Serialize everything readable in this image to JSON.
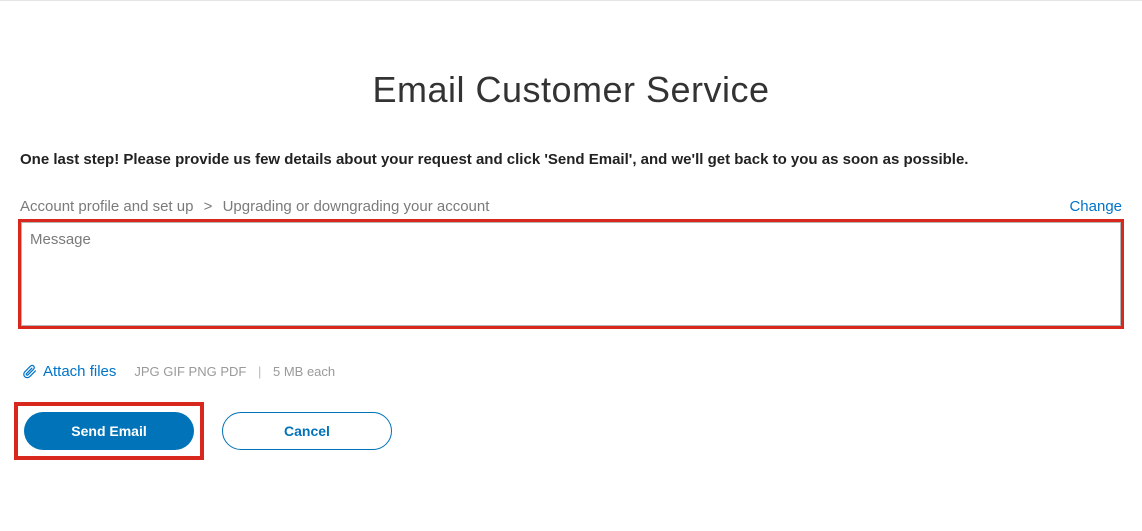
{
  "page": {
    "title": "Email Customer Service",
    "instruction": "One last step! Please provide us few details about your request and click 'Send Email', and we'll get back to you as soon as possible."
  },
  "breadcrumb": {
    "level1": "Account profile and set up",
    "sep": ">",
    "level2": "Upgrading or downgrading your account",
    "change_label": "Change"
  },
  "message": {
    "placeholder": "Message",
    "value": ""
  },
  "attach": {
    "link_label": "Attach files",
    "formats": "JPG GIF PNG PDF",
    "size_hint": "5 MB each"
  },
  "buttons": {
    "send": "Send Email",
    "cancel": "Cancel"
  },
  "highlight_color": "#d8271c",
  "accent_color": "#0073b9"
}
